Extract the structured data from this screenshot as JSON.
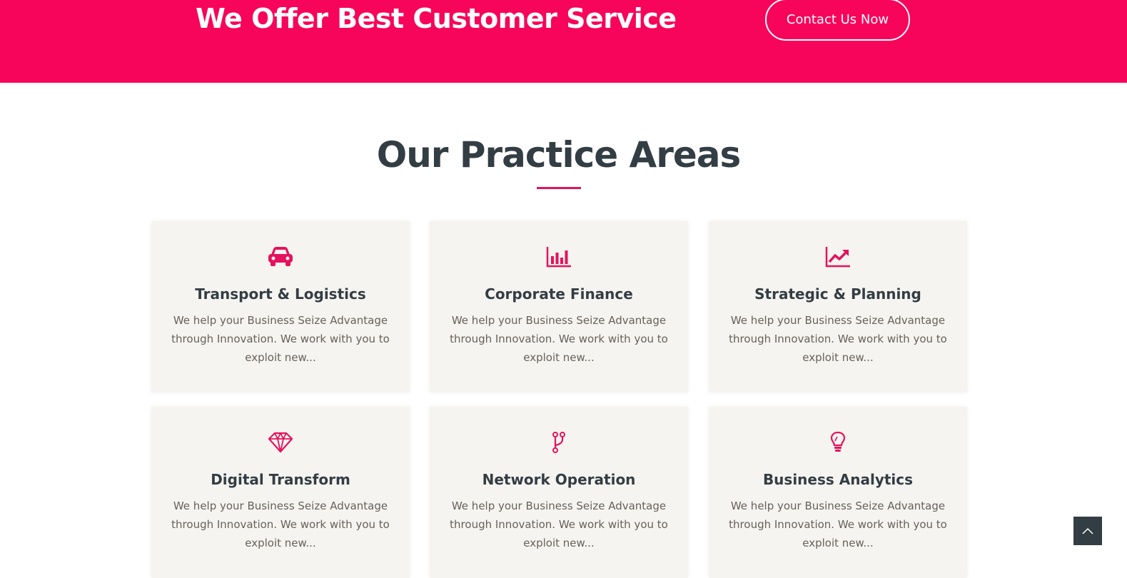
{
  "banner": {
    "title": "We Offer Best Customer Service",
    "contact_label": "Contact Us Now"
  },
  "section": {
    "title": "Our Practice Areas"
  },
  "cards": [
    {
      "icon": "car-icon",
      "title": "Transport & Logistics",
      "description": "We help your Business Seize Advantage through Innovation. We work with you to exploit new..."
    },
    {
      "icon": "bar-chart-icon",
      "title": "Corporate Finance",
      "description": "We help your Business Seize Advantage through Innovation. We work with you to exploit new..."
    },
    {
      "icon": "line-chart-icon",
      "title": "Strategic & Planning",
      "description": "We help your Business Seize Advantage through Innovation. We work with you to exploit new..."
    },
    {
      "icon": "diamond-icon",
      "title": "Digital Transform",
      "description": "We help your Business Seize Advantage through Innovation. We work with you to exploit new..."
    },
    {
      "icon": "code-branch-icon",
      "title": "Network Operation",
      "description": "We help your Business Seize Advantage through Innovation. We work with you to exploit new..."
    },
    {
      "icon": "lightbulb-icon",
      "title": "Business Analytics",
      "description": "We help your Business Seize Advantage through Innovation. We work with you to exploit new..."
    }
  ],
  "scroll_top": {
    "icon": "chevron-up-icon"
  },
  "colors": {
    "accent": "#f7055a",
    "icon": "#e5125d",
    "heading": "#333d44",
    "card_background": "#f6f4f0",
    "body_text": "#66615c"
  }
}
